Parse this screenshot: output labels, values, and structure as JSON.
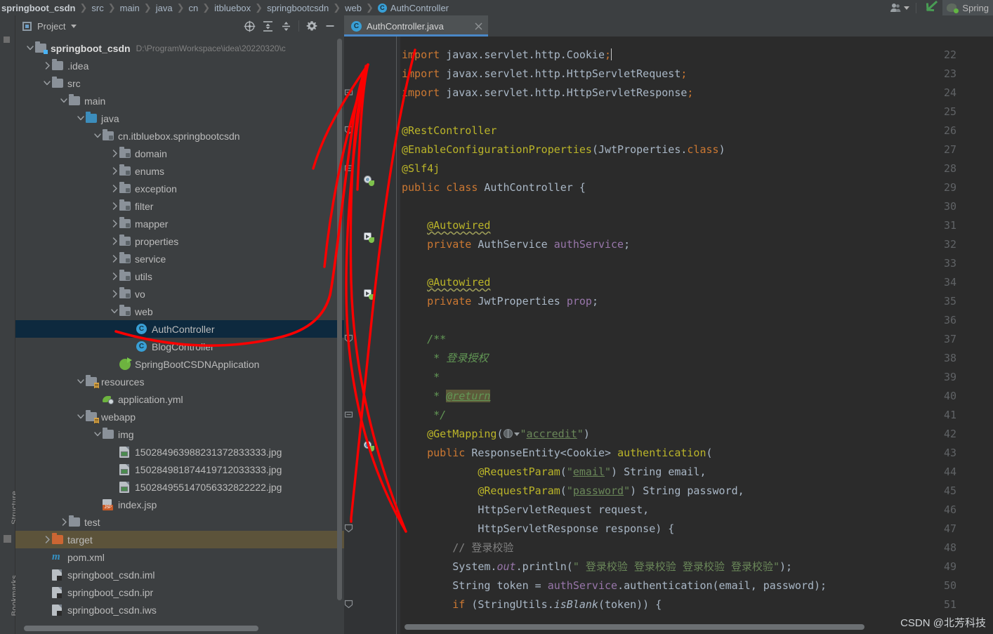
{
  "breadcrumb": {
    "items": [
      {
        "label": "springboot_csdn",
        "bold": true,
        "icon": ""
      },
      {
        "label": "src",
        "bold": false,
        "icon": ""
      },
      {
        "label": "main",
        "bold": false,
        "icon": ""
      },
      {
        "label": "java",
        "bold": false,
        "icon": ""
      },
      {
        "label": "cn",
        "bold": false,
        "icon": ""
      },
      {
        "label": "itbluebox",
        "bold": false,
        "icon": ""
      },
      {
        "label": "springbootcsdn",
        "bold": false,
        "icon": ""
      },
      {
        "label": "web",
        "bold": false,
        "icon": ""
      },
      {
        "label": "AuthController",
        "bold": false,
        "icon": "class-icon"
      }
    ],
    "separator": "❯",
    "class_icon_letter": "C"
  },
  "navbar_right": {
    "user_icon": "user-account-icon",
    "user_caret": "chevron-down-icon",
    "checkmark_icon": "green-check-arrow-icon",
    "run_config_label": "Spring",
    "run_config_icon": "spring-boot-icon"
  },
  "left_strip": {
    "tabs": [
      "Structure",
      "Bookmarks"
    ]
  },
  "project_panel": {
    "title": "Project",
    "title_icon": "project-view-icon",
    "dropdown_icon": "chevron-down-icon",
    "tools": [
      {
        "name": "locate-file-icon",
        "label": "Select Opened File"
      },
      {
        "name": "expand-all-icon",
        "label": "Expand All"
      },
      {
        "name": "collapse-all-icon",
        "label": "Collapse All"
      },
      {
        "name": "gear-icon",
        "label": "Settings"
      },
      {
        "name": "minimize-icon",
        "label": "Hide"
      }
    ],
    "tree": [
      {
        "label": "springboot_csdn",
        "sub": "D:\\ProgramWorkspace\\idea\\20220320\\c",
        "depth": 0,
        "arrow": "down",
        "icon": "module-folder",
        "bold": true,
        "state": "normal"
      },
      {
        "label": ".idea",
        "sub": "",
        "depth": 1,
        "arrow": "right",
        "icon": "folder",
        "bold": false,
        "state": "normal"
      },
      {
        "label": "src",
        "sub": "",
        "depth": 1,
        "arrow": "down",
        "icon": "folder",
        "bold": false,
        "state": "normal"
      },
      {
        "label": "main",
        "sub": "",
        "depth": 2,
        "arrow": "down",
        "icon": "folder",
        "bold": false,
        "state": "normal"
      },
      {
        "label": "java",
        "sub": "",
        "depth": 3,
        "arrow": "down",
        "icon": "source-folder",
        "bold": false,
        "state": "normal"
      },
      {
        "label": "cn.itbluebox.springbootcsdn",
        "sub": "",
        "depth": 4,
        "arrow": "down",
        "icon": "package",
        "bold": false,
        "state": "normal"
      },
      {
        "label": "domain",
        "sub": "",
        "depth": 5,
        "arrow": "right",
        "icon": "package",
        "bold": false,
        "state": "normal"
      },
      {
        "label": "enums",
        "sub": "",
        "depth": 5,
        "arrow": "right",
        "icon": "package",
        "bold": false,
        "state": "normal"
      },
      {
        "label": "exception",
        "sub": "",
        "depth": 5,
        "arrow": "right",
        "icon": "package",
        "bold": false,
        "state": "normal"
      },
      {
        "label": "filter",
        "sub": "",
        "depth": 5,
        "arrow": "right",
        "icon": "package",
        "bold": false,
        "state": "normal"
      },
      {
        "label": "mapper",
        "sub": "",
        "depth": 5,
        "arrow": "right",
        "icon": "package",
        "bold": false,
        "state": "normal"
      },
      {
        "label": "properties",
        "sub": "",
        "depth": 5,
        "arrow": "right",
        "icon": "package",
        "bold": false,
        "state": "normal"
      },
      {
        "label": "service",
        "sub": "",
        "depth": 5,
        "arrow": "right",
        "icon": "package",
        "bold": false,
        "state": "normal"
      },
      {
        "label": "utils",
        "sub": "",
        "depth": 5,
        "arrow": "right",
        "icon": "package",
        "bold": false,
        "state": "normal"
      },
      {
        "label": "vo",
        "sub": "",
        "depth": 5,
        "arrow": "right",
        "icon": "package",
        "bold": false,
        "state": "normal"
      },
      {
        "label": "web",
        "sub": "",
        "depth": 5,
        "arrow": "down",
        "icon": "package",
        "bold": false,
        "state": "normal"
      },
      {
        "label": "AuthController",
        "sub": "",
        "depth": 6,
        "arrow": "none",
        "icon": "java-class",
        "bold": false,
        "state": "selected"
      },
      {
        "label": "BlogController",
        "sub": "",
        "depth": 6,
        "arrow": "none",
        "icon": "java-class",
        "bold": false,
        "state": "normal"
      },
      {
        "label": "SpringBootCSDNApplication",
        "sub": "",
        "depth": 5,
        "arrow": "none",
        "icon": "spring-boot-class",
        "bold": false,
        "state": "normal"
      },
      {
        "label": "resources",
        "sub": "",
        "depth": 3,
        "arrow": "down",
        "icon": "resources-folder",
        "bold": false,
        "state": "normal"
      },
      {
        "label": "application.yml",
        "sub": "",
        "depth": 4,
        "arrow": "none",
        "icon": "spring-yaml",
        "bold": false,
        "state": "normal"
      },
      {
        "label": "webapp",
        "sub": "",
        "depth": 3,
        "arrow": "down",
        "icon": "resources-folder",
        "bold": false,
        "state": "normal"
      },
      {
        "label": "img",
        "sub": "",
        "depth": 4,
        "arrow": "down",
        "icon": "folder",
        "bold": false,
        "state": "normal"
      },
      {
        "label": "150284963988231372833333.jpg",
        "sub": "",
        "depth": 5,
        "arrow": "none",
        "icon": "image-file",
        "bold": false,
        "state": "normal"
      },
      {
        "label": "150284981874419712033333.jpg",
        "sub": "",
        "depth": 5,
        "arrow": "none",
        "icon": "image-file",
        "bold": false,
        "state": "normal"
      },
      {
        "label": "150284955147056332822222.jpg",
        "sub": "",
        "depth": 5,
        "arrow": "none",
        "icon": "image-file",
        "bold": false,
        "state": "normal"
      },
      {
        "label": "index.jsp",
        "sub": "",
        "depth": 4,
        "arrow": "none",
        "icon": "jsp-file",
        "bold": false,
        "state": "normal"
      },
      {
        "label": "test",
        "sub": "",
        "depth": 2,
        "arrow": "right",
        "icon": "folder",
        "bold": false,
        "state": "normal"
      },
      {
        "label": "target",
        "sub": "",
        "depth": 1,
        "arrow": "right",
        "icon": "excluded-folder",
        "bold": false,
        "state": "highlighted"
      },
      {
        "label": "pom.xml",
        "sub": "",
        "depth": 1,
        "arrow": "none",
        "icon": "maven-file",
        "bold": false,
        "state": "normal"
      },
      {
        "label": "springboot_csdn.iml",
        "sub": "",
        "depth": 1,
        "arrow": "none",
        "icon": "iml-file",
        "bold": false,
        "state": "normal"
      },
      {
        "label": "springboot_csdn.ipr",
        "sub": "",
        "depth": 1,
        "arrow": "none",
        "icon": "iml-file",
        "bold": false,
        "state": "normal"
      },
      {
        "label": "springboot_csdn.iws",
        "sub": "",
        "depth": 1,
        "arrow": "none",
        "icon": "iml-file",
        "bold": false,
        "state": "normal"
      }
    ]
  },
  "editor": {
    "tab": {
      "label": "AuthController.java",
      "icon": "java-class-icon",
      "close_icon": "close-icon"
    },
    "first_line_number": 22,
    "lines": [
      {
        "n": 22,
        "gutter": "",
        "fold": "",
        "tokens": [
          {
            "t": "import ",
            "c": "kw"
          },
          {
            "t": "javax.servlet.http.Cookie",
            "c": "typ"
          },
          {
            "t": ";",
            "c": "kw"
          },
          {
            "t": "|",
            "c": "caret"
          }
        ]
      },
      {
        "n": 23,
        "gutter": "",
        "fold": "",
        "tokens": [
          {
            "t": "import ",
            "c": "kw"
          },
          {
            "t": "javax.servlet.http.HttpServletRequest",
            "c": "typ"
          },
          {
            "t": ";",
            "c": "kw"
          }
        ]
      },
      {
        "n": 24,
        "gutter": "",
        "fold": "minus",
        "tokens": [
          {
            "t": "import ",
            "c": "kw"
          },
          {
            "t": "javax.servlet.http.HttpServletResponse",
            "c": "typ"
          },
          {
            "t": ";",
            "c": "kw"
          }
        ]
      },
      {
        "n": 25,
        "gutter": "",
        "fold": "",
        "tokens": []
      },
      {
        "n": 26,
        "gutter": "",
        "fold": "top",
        "tokens": [
          {
            "t": "@RestController",
            "c": "ann"
          }
        ]
      },
      {
        "n": 27,
        "gutter": "",
        "fold": "",
        "tokens": [
          {
            "t": "@EnableConfigurationProperties",
            "c": "ann"
          },
          {
            "t": "(",
            "c": "typ"
          },
          {
            "t": "JwtProperties.",
            "c": "typ"
          },
          {
            "t": "class",
            "c": "kw"
          },
          {
            "t": ")",
            "c": "typ"
          }
        ]
      },
      {
        "n": 28,
        "gutter": "",
        "fold": "minus",
        "tokens": [
          {
            "t": "@Slf4j",
            "c": "ann"
          }
        ]
      },
      {
        "n": 29,
        "gutter": "spring-bean",
        "fold": "",
        "tokens": [
          {
            "t": "public ",
            "c": "kw"
          },
          {
            "t": "class ",
            "c": "kw"
          },
          {
            "t": "AuthController ",
            "c": "typ"
          },
          {
            "t": "{",
            "c": "typ"
          }
        ]
      },
      {
        "n": 30,
        "gutter": "",
        "fold": "",
        "tokens": []
      },
      {
        "n": 31,
        "gutter": "",
        "fold": "",
        "tokens": [
          {
            "t": "    ",
            "c": "typ"
          },
          {
            "t": "@Autowired",
            "c": "ann wavy"
          }
        ]
      },
      {
        "n": 32,
        "gutter": "spring-arrow",
        "fold": "",
        "tokens": [
          {
            "t": "    ",
            "c": "typ"
          },
          {
            "t": "private ",
            "c": "kw"
          },
          {
            "t": "AuthService ",
            "c": "typ"
          },
          {
            "t": "authService",
            "c": "fld"
          },
          {
            "t": ";",
            "c": "typ"
          }
        ]
      },
      {
        "n": 33,
        "gutter": "",
        "fold": "",
        "tokens": []
      },
      {
        "n": 34,
        "gutter": "",
        "fold": "",
        "tokens": [
          {
            "t": "    ",
            "c": "typ"
          },
          {
            "t": "@Autowired",
            "c": "ann wavy"
          }
        ]
      },
      {
        "n": 35,
        "gutter": "spring-arrow",
        "fold": "",
        "tokens": [
          {
            "t": "    ",
            "c": "typ"
          },
          {
            "t": "private ",
            "c": "kw"
          },
          {
            "t": "JwtProperties ",
            "c": "typ"
          },
          {
            "t": "prop",
            "c": "fld"
          },
          {
            "t": ";",
            "c": "typ"
          }
        ]
      },
      {
        "n": 36,
        "gutter": "",
        "fold": "",
        "tokens": []
      },
      {
        "n": 37,
        "gutter": "",
        "fold": "top",
        "tokens": [
          {
            "t": "    /**",
            "c": "cmt"
          }
        ]
      },
      {
        "n": 38,
        "gutter": "",
        "fold": "",
        "tokens": [
          {
            "t": "     * ",
            "c": "cmt"
          },
          {
            "t": "登录授权",
            "c": "cmt"
          }
        ]
      },
      {
        "n": 39,
        "gutter": "",
        "fold": "",
        "tokens": [
          {
            "t": "     *",
            "c": "cmt"
          }
        ]
      },
      {
        "n": 40,
        "gutter": "",
        "fold": "",
        "tokens": [
          {
            "t": "     * ",
            "c": "cmt"
          },
          {
            "t": "@return",
            "c": "rethl"
          }
        ]
      },
      {
        "n": 41,
        "gutter": "",
        "fold": "minus",
        "tokens": [
          {
            "t": "     */",
            "c": "cmt"
          }
        ]
      },
      {
        "n": 42,
        "gutter": "",
        "fold": "",
        "tokens": [
          {
            "t": "    ",
            "c": "typ"
          },
          {
            "t": "@GetMapping",
            "c": "ann"
          },
          {
            "t": "(",
            "c": "typ"
          },
          {
            "t": "GLOBE",
            "c": "globe"
          },
          {
            "t": "\"",
            "c": "str"
          },
          {
            "t": "accredit",
            "c": "str ulink"
          },
          {
            "t": "\"",
            "c": "str"
          },
          {
            "t": ")",
            "c": "typ"
          }
        ]
      },
      {
        "n": 43,
        "gutter": "spring-globe",
        "fold": "",
        "tokens": [
          {
            "t": "    ",
            "c": "typ"
          },
          {
            "t": "public ",
            "c": "kw"
          },
          {
            "t": "ResponseEntity<Cookie> ",
            "c": "typ"
          },
          {
            "t": "authentication",
            "c": "ann"
          },
          {
            "t": "(",
            "c": "typ"
          }
        ]
      },
      {
        "n": 44,
        "gutter": "",
        "fold": "",
        "tokens": [
          {
            "t": "            ",
            "c": "typ"
          },
          {
            "t": "@RequestParam",
            "c": "ann"
          },
          {
            "t": "(",
            "c": "typ"
          },
          {
            "t": "\"",
            "c": "str"
          },
          {
            "t": "email",
            "c": "str ulink"
          },
          {
            "t": "\"",
            "c": "str"
          },
          {
            "t": ") ",
            "c": "typ"
          },
          {
            "t": "String ",
            "c": "typ"
          },
          {
            "t": "email",
            "c": "typ"
          },
          {
            "t": ",",
            "c": "typ"
          }
        ]
      },
      {
        "n": 45,
        "gutter": "",
        "fold": "",
        "tokens": [
          {
            "t": "            ",
            "c": "typ"
          },
          {
            "t": "@RequestParam",
            "c": "ann"
          },
          {
            "t": "(",
            "c": "typ"
          },
          {
            "t": "\"",
            "c": "str"
          },
          {
            "t": "password",
            "c": "str ulink"
          },
          {
            "t": "\"",
            "c": "str"
          },
          {
            "t": ") ",
            "c": "typ"
          },
          {
            "t": "String ",
            "c": "typ"
          },
          {
            "t": "password",
            "c": "typ"
          },
          {
            "t": ",",
            "c": "typ"
          }
        ]
      },
      {
        "n": 46,
        "gutter": "",
        "fold": "",
        "tokens": [
          {
            "t": "            HttpServletRequest request,",
            "c": "typ"
          }
        ]
      },
      {
        "n": 47,
        "gutter": "",
        "fold": "top",
        "tokens": [
          {
            "t": "            HttpServletResponse response) {",
            "c": "typ"
          }
        ]
      },
      {
        "n": 48,
        "gutter": "",
        "fold": "",
        "tokens": [
          {
            "t": "        // 登录校验",
            "c": "lcmt"
          }
        ]
      },
      {
        "n": 49,
        "gutter": "",
        "fold": "",
        "tokens": [
          {
            "t": "        System.",
            "c": "typ"
          },
          {
            "t": "out",
            "c": "stat"
          },
          {
            "t": ".println(",
            "c": "typ"
          },
          {
            "t": "\" 登录校验 登录校验 登录校验 登录校验\"",
            "c": "str"
          },
          {
            "t": ");",
            "c": "typ"
          }
        ]
      },
      {
        "n": 50,
        "gutter": "",
        "fold": "",
        "tokens": [
          {
            "t": "        String ",
            "c": "typ"
          },
          {
            "t": "token = ",
            "c": "typ"
          },
          {
            "t": "authService",
            "c": "fld"
          },
          {
            "t": ".authentication(email, password);",
            "c": "typ"
          }
        ]
      },
      {
        "n": 51,
        "gutter": "",
        "fold": "top",
        "tokens": [
          {
            "t": "        ",
            "c": "typ"
          },
          {
            "t": "if ",
            "c": "kw"
          },
          {
            "t": "(StringUtils.",
            "c": "typ"
          },
          {
            "t": "isBlank",
            "c": "statm"
          },
          {
            "t": "(token)) {",
            "c": "typ"
          }
        ]
      }
    ]
  },
  "watermark": "CSDN @北芳科技",
  "colors": {
    "panel_bg": "#3c3f41",
    "editor_bg": "#2b2b2b",
    "gutter_bg": "#313335",
    "selection_bg": "#0d293e",
    "highlight_bg": "#5c533a",
    "accent_blue": "#4a88c7",
    "annotation_red": "#ff0000",
    "keyword": "#cc7832",
    "string": "#6a8759",
    "annotation": "#bbb529",
    "comment": "#629755",
    "field": "#9876aa"
  }
}
